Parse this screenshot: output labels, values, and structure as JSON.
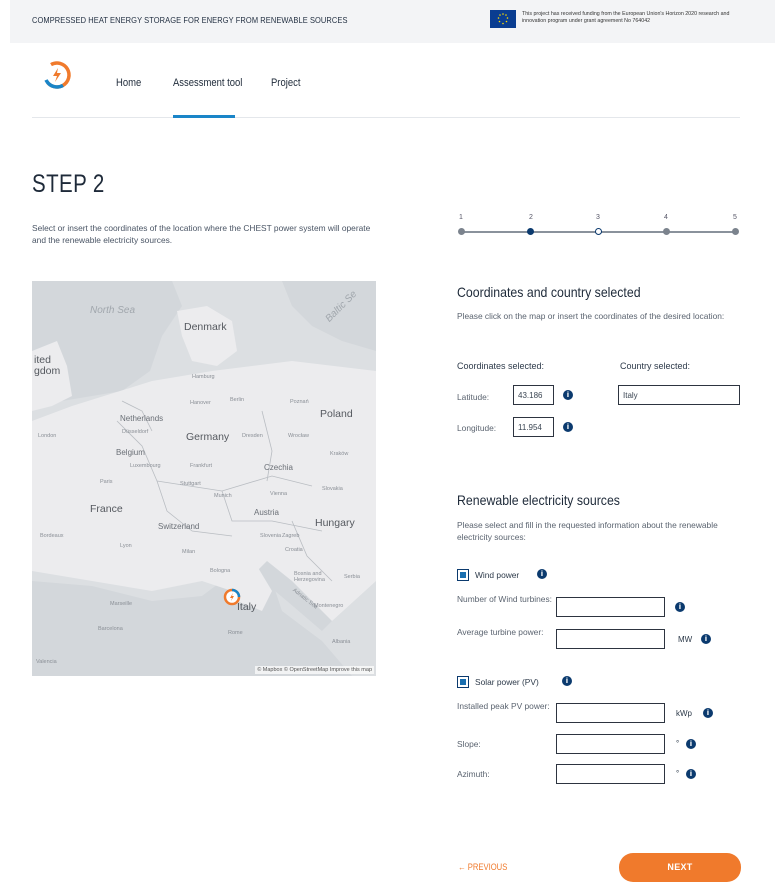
{
  "header": {
    "title": "COMPRESSED HEAT ENERGY STORAGE FOR ENERGY FROM RENEWABLE SOURCES",
    "funding": "This project has received funding from the European Union's Horizon 2020 research and innovation program under grant agreement No 764042"
  },
  "nav": {
    "items": [
      {
        "label": "Home"
      },
      {
        "label": "Assessment tool"
      },
      {
        "label": "Project"
      }
    ],
    "active": "Assessment tool"
  },
  "step": {
    "title": "STEP 2",
    "intro": "Select or insert the coordinates of the location where the CHEST power system will operate and the renewable electricity sources.",
    "current": 2,
    "labels": [
      "1",
      "2",
      "3",
      "4",
      "5"
    ]
  },
  "map": {
    "labels": {
      "north_sea": "North\nSea",
      "baltic": "Baltic Se",
      "denmark": "Denmark",
      "kingdom": "ited\ngdom",
      "netherlands": "Netherlands",
      "germany": "Germany",
      "poland": "Poland",
      "belgium": "Belgium",
      "luxembourg": "Luxembourg",
      "czechia": "Czechia",
      "france": "France",
      "austria": "Austria",
      "slovakia": "Slovakia",
      "switzerland": "Switzerland",
      "hungary": "Hungary",
      "slovenia": "Slovenia",
      "croatia": "Croatia",
      "serbia": "Serbia",
      "bosnia": "Bosnia and\nHerzegovina",
      "italy": "Italy",
      "montenegro": "Montenegro",
      "albania": "Albania",
      "hamburg": "Hamburg",
      "berlin": "Berlin",
      "hanover": "Hanover",
      "poznan": "Poznań",
      "london": "London",
      "paris": "Paris",
      "frankfurt": "Frankfurt",
      "stuttgart": "Stuttgart",
      "munich": "Munich",
      "vienna": "Vienna",
      "milan": "Milan",
      "bologna": "Bologna",
      "rome": "Rome",
      "marseille": "Marseille",
      "barcelona": "Barcelona",
      "dusseldorf": "Düsseldorf",
      "dresden": "Dresden",
      "wroclaw": "Wrocław",
      "krakow": "Kraków",
      "zagreb": "Zagreb",
      "valencia": "Valencia",
      "lyon": "Lyon",
      "bordeaux": "Bordeaux",
      "adriatic": "Adriatic Sea"
    },
    "attribution": "© Mapbox © OpenStreetMap Improve this map"
  },
  "coordinates": {
    "title": "Coordinates and country selected",
    "help": "Please click on the map or insert the coordinates of the desired location:",
    "coords_heading": "Coordinates selected:",
    "country_heading": "Country selected:",
    "latitude_label": "Latitude:",
    "latitude_value": "43.186",
    "longitude_label": "Longitude:",
    "longitude_value": "11.954",
    "country_value": "Italy"
  },
  "renewables": {
    "title": "Renewable electricity sources",
    "help": "Please select and fill in the requested information about the renewable electricity sources:",
    "wind": {
      "label": "Wind power",
      "turbines_label": "Number of Wind turbines:",
      "turbine_power_label": "Average turbine power:",
      "turbine_power_unit": "MW"
    },
    "solar": {
      "label": "Solar power (PV)",
      "peak_label": "Installed peak PV power:",
      "peak_unit": "kWp",
      "slope_label": "Slope:",
      "slope_unit": "°",
      "azimuth_label": "Azimuth:",
      "azimuth_unit": "°"
    }
  },
  "footer": {
    "prev_label": "← PREVIOUS",
    "next_label": "NEXT"
  },
  "colors": {
    "accent": "#f07a2c",
    "nav_active": "#1a85c8",
    "dark_blue": "#0b3a6e"
  }
}
